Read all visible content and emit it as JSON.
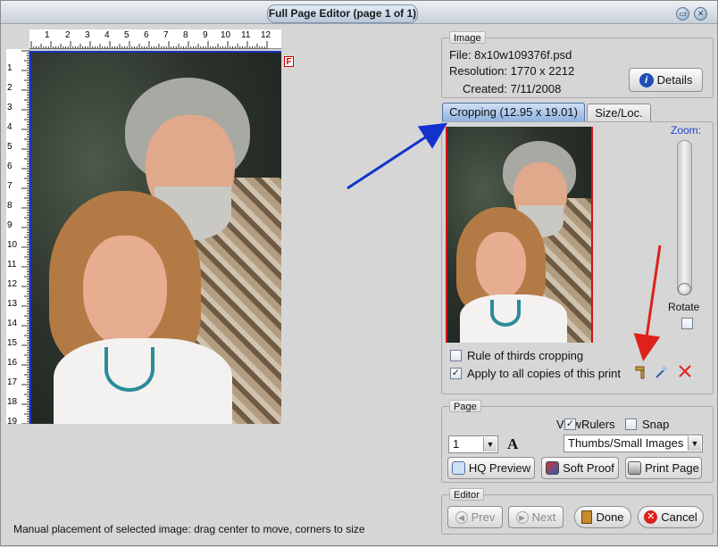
{
  "window": {
    "title": "Full Page Editor (page 1 of 1)"
  },
  "ruler": {
    "top_numbers": [
      "1",
      "2",
      "3",
      "4",
      "5",
      "6",
      "7",
      "8",
      "9",
      "10",
      "11",
      "12"
    ],
    "left_numbers": [
      "1",
      "2",
      "3",
      "4",
      "5",
      "6",
      "7",
      "8",
      "9",
      "10",
      "11",
      "12",
      "13",
      "14",
      "15",
      "16",
      "17",
      "18",
      "19"
    ],
    "corner_marker": "F"
  },
  "status_text": "Manual placement of selected image: drag center to move, corners to size",
  "image_group": {
    "title": "Image",
    "file": "File: 8x10w109376f.psd",
    "resolution": "Resolution: 1770 x 2212",
    "created": "Created: 7/11/2008",
    "details_label": "Details"
  },
  "crop_tabs": {
    "cropping_label": "Cropping (12.95 x 19.01)",
    "size_loc_label": "Size/Loc.",
    "zoom_label": "Zoom:",
    "rotate_label": "Rotate",
    "rule_of_thirds_label": "Rule of thirds cropping",
    "rule_of_thirds_checked": false,
    "apply_all_label": "Apply to all copies of this print",
    "apply_all_checked": true
  },
  "page_group": {
    "title": "Page",
    "view_label": "View:",
    "rulers_label": "Rulers",
    "rulers_checked": true,
    "snap_label": "Snap",
    "snap_checked": false,
    "page_number_value": "1",
    "view_mode_value": "Thumbs/Small Images",
    "hq_preview_label": "HQ Preview",
    "soft_proof_label": "Soft Proof",
    "print_page_label": "Print Page"
  },
  "editor_group": {
    "title": "Editor",
    "prev_label": "Prev",
    "next_label": "Next",
    "done_label": "Done",
    "cancel_label": "Cancel"
  },
  "colors": {
    "accent_blue": "#1133cc",
    "annotation_red": "#e0201c",
    "crop_border_red": "#d01414",
    "zoom_label_blue": "#2244cc"
  }
}
